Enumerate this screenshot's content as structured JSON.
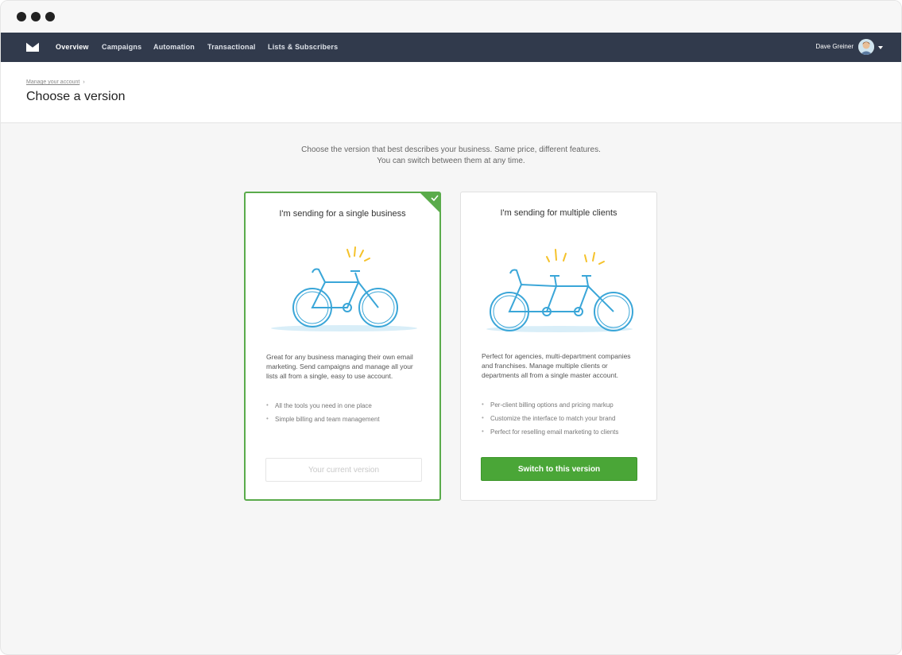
{
  "nav": {
    "items": [
      {
        "label": "Overview",
        "active": true
      },
      {
        "label": "Campaigns"
      },
      {
        "label": "Automation"
      },
      {
        "label": "Transactional"
      },
      {
        "label": "Lists & Subscribers"
      }
    ],
    "user_name": "Dave Greiner"
  },
  "header": {
    "breadcrumb": "Manage your account",
    "breadcrumb_sep": "›",
    "title": "Choose a version"
  },
  "intro": {
    "line1": "Choose the version that best describes your business. Same price, different features.",
    "line2": "You can switch between them at any time."
  },
  "cards": [
    {
      "title": "I'm sending for a single business",
      "description": "Great for any business managing their own email marketing. Send campaigns and manage all your lists all from a single, easy to use account.",
      "features": [
        "All the tools you need in one place",
        "Simple billing and team management"
      ],
      "button": "Your current version",
      "selected": true
    },
    {
      "title": "I'm sending for multiple clients",
      "description": "Perfect for agencies, multi-department companies and franchises. Manage multiple clients or departments all from a single master account.",
      "features": [
        "Per-client billing options and pricing markup",
        "Customize the interface to match your brand",
        "Perfect for reselling email marketing to clients"
      ],
      "button": "Switch to this version",
      "selected": false
    }
  ],
  "colors": {
    "nav_bg": "#313a4c",
    "accent_green": "#4aa637",
    "illustration_blue": "#3aa6d8",
    "spark_yellow": "#f5c22b"
  }
}
